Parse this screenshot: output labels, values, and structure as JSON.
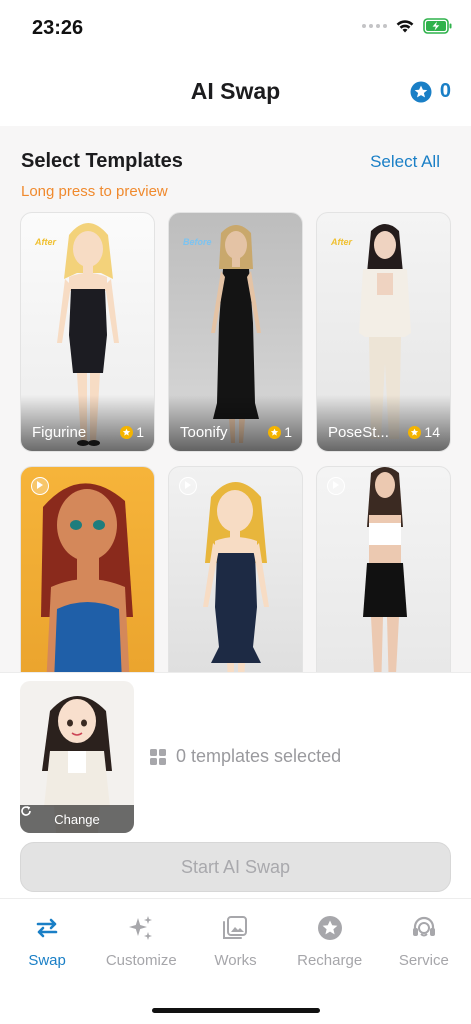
{
  "status_bar": {
    "time": "23:26"
  },
  "header": {
    "title": "AI Swap",
    "coin_count": "0"
  },
  "section": {
    "title": "Select Templates",
    "select_all_label": "Select All",
    "hint": "Long press to preview"
  },
  "templates": [
    {
      "name": "Figurine",
      "cost": "1",
      "tag": "After"
    },
    {
      "name": "Toonify",
      "cost": "1",
      "tag": "Before"
    },
    {
      "name": "PoseSt...",
      "cost": "14",
      "tag": "After"
    },
    {
      "name": "",
      "cost": "",
      "tag": ""
    },
    {
      "name": "",
      "cost": "",
      "tag": ""
    },
    {
      "name": "",
      "cost": "",
      "tag": ""
    }
  ],
  "upload": {
    "change_label": "Change"
  },
  "selection": {
    "summary": "0 templates selected"
  },
  "start_button": {
    "label": "Start AI Swap"
  },
  "tab_bar": {
    "items": [
      {
        "label": "Swap",
        "icon": "swap-icon",
        "active": true
      },
      {
        "label": "Customize",
        "icon": "sparkle-icon",
        "active": false
      },
      {
        "label": "Works",
        "icon": "gallery-icon",
        "active": false
      },
      {
        "label": "Recharge",
        "icon": "star-badge-icon",
        "active": false
      },
      {
        "label": "Service",
        "icon": "headset-icon",
        "active": false
      }
    ]
  },
  "colors": {
    "accent": "#1a7fc6",
    "hint": "#f08a2e",
    "coin": "#f4b400"
  }
}
